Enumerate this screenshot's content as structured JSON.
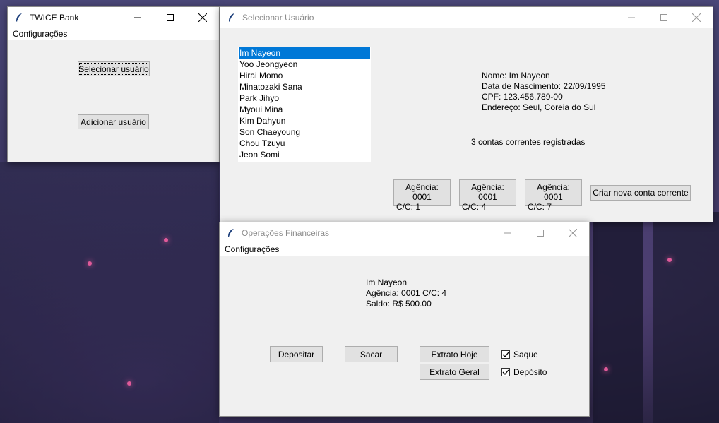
{
  "main_window": {
    "title": "TWICE Bank",
    "menu": "Configurações",
    "select_button": "Selecionar usuário",
    "add_button": "Adicionar usuário"
  },
  "select_window": {
    "title": "Selecionar Usuário",
    "users": [
      "Im Nayeon",
      "Yoo Jeongyeon",
      "Hirai Momo",
      "Minatozaki Sana",
      "Park Jihyo",
      "Myoui Mina",
      "Kim Dahyun",
      "Son Chaeyoung",
      "Chou Tzuyu",
      "Jeon Somi"
    ],
    "selected_user": "Im Nayeon",
    "details": {
      "name": "Nome: Im Nayeon",
      "birth": "Data de Nascimento: 22/09/1995",
      "cpf": "CPF: 123.456.789-00",
      "address": "Endereço: Seul, Coreia do Sul"
    },
    "accounts_count": "3 contas correntes registradas",
    "accounts": [
      {
        "line1": "Agência: 0001",
        "line2": "C/C: 1"
      },
      {
        "line1": "Agência: 0001",
        "line2": "C/C: 4"
      },
      {
        "line1": "Agência: 0001",
        "line2": "C/C: 7"
      }
    ],
    "new_account_button": "Criar nova conta corrente"
  },
  "ops_window": {
    "title": "Operações Financeiras",
    "menu": "Configurações",
    "info": {
      "name": "Im Nayeon",
      "account": "Agência: 0001 C/C: 4",
      "balance": "Saldo: R$ 500.00"
    },
    "deposit_button": "Depositar",
    "withdraw_button": "Sacar",
    "statement_today_button": "Extrato Hoje",
    "statement_all_button": "Extrato Geral",
    "filter_withdraw": {
      "label": "Saque",
      "checked": true
    },
    "filter_deposit": {
      "label": "Depósito",
      "checked": true
    }
  }
}
